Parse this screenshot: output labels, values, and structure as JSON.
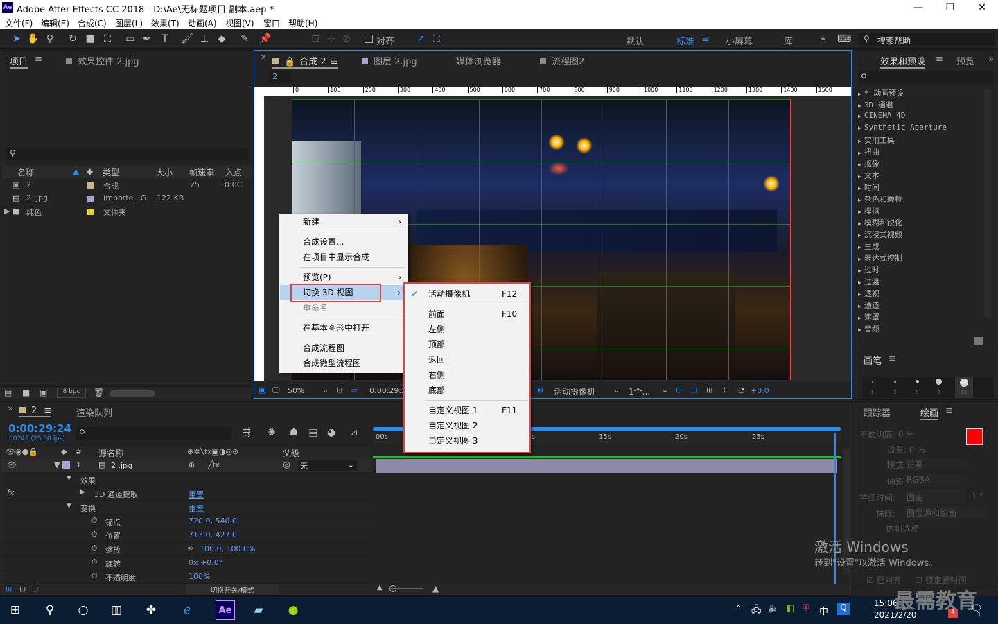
{
  "window": {
    "title": "Adobe After Effects CC 2018 - D:\\Ae\\无标题项目 副本.aep *",
    "app_icon": "Ae"
  },
  "menubar": [
    "文件(F)",
    "编辑(E)",
    "合成(C)",
    "图层(L)",
    "效果(T)",
    "动画(A)",
    "视图(V)",
    "窗口",
    "帮助(H)"
  ],
  "toolbar": {
    "align_label": "对齐",
    "workspaces": [
      "默认",
      "标准",
      "小屏幕",
      "库"
    ],
    "active_workspace": "标准",
    "search_placeholder": "搜索帮助"
  },
  "project_panel": {
    "tab": "项目",
    "tab2": "效果控件 2.jpg",
    "columns": [
      "名称",
      "类型",
      "大小",
      "帧速率",
      "入点"
    ],
    "items": [
      {
        "name": "2",
        "type": "合成",
        "size": "",
        "fps": "25",
        "in": "0:0C"
      },
      {
        "name": "2 .jpg",
        "type": "Importe...G",
        "size": "122 KB",
        "fps": "",
        "in": ""
      },
      {
        "name": "纯色",
        "type": "文件夹",
        "size": "",
        "fps": "",
        "in": ""
      }
    ],
    "bpc": "8 bpc"
  },
  "comp_panel": {
    "tabs": [
      "合成 2",
      "图层 2.jpg",
      "媒体浏览器",
      "流程图2"
    ],
    "breadcrumb": "2",
    "ruler": [
      "0",
      "100",
      "200",
      "300",
      "400",
      "500",
      "600",
      "700",
      "800",
      "900",
      "1000",
      "1100",
      "1200",
      "1300",
      "1400",
      "1500"
    ],
    "zoom": "50%",
    "timecode": "0:00:29:24",
    "camera": "活动摄像机",
    "views": "1个...",
    "exposure": "+0.0"
  },
  "context_menu": {
    "items": [
      "新建",
      "合成设置...",
      "在项目中显示合成",
      "预览(P)",
      "切换 3D 视图",
      "重命名",
      "在基本图形中打开",
      "合成流程图",
      "合成微型流程图"
    ],
    "highlighted": "切换 3D 视图",
    "disabled": "重命名"
  },
  "submenu": {
    "items": [
      {
        "label": "活动摄像机",
        "key": "F12",
        "checked": true
      },
      {
        "label": "前面",
        "key": "F10"
      },
      {
        "label": "左侧",
        "key": ""
      },
      {
        "label": "顶部",
        "key": ""
      },
      {
        "label": "返回",
        "key": ""
      },
      {
        "label": "右侧",
        "key": ""
      },
      {
        "label": "底部",
        "key": ""
      },
      {
        "label": "自定义视图 1",
        "key": "F11"
      },
      {
        "label": "自定义视图 2",
        "key": ""
      },
      {
        "label": "自定义视图 3",
        "key": ""
      }
    ]
  },
  "effects_panel": {
    "tab": "效果和预设",
    "tab2": "预览",
    "items": [
      "* 动画预设",
      "3D 通道",
      "CINEMA 4D",
      "Synthetic Aperture",
      "实用工具",
      "扭曲",
      "抠像",
      "文本",
      "时间",
      "杂色和颗粒",
      "模拟",
      "模糊和锐化",
      "沉浸式视频",
      "生成",
      "表达式控制",
      "过时",
      "过渡",
      "透视",
      "通道",
      "遮罩",
      "音频"
    ]
  },
  "brush_panel": {
    "tab": "画笔",
    "sizes": [
      "1",
      "3",
      "5",
      "9",
      "13"
    ]
  },
  "paint_panel": {
    "tab_tracker": "跟踪器",
    "tab_paint": "绘画",
    "opacity": "不透明度: 0 %",
    "flow": "流量: 0 %",
    "mode_label": "模式:",
    "mode": "正常",
    "channel_label": "通道:",
    "channel": "RGBA",
    "duration_label": "持续时间:",
    "duration": "固定",
    "frames": "1 f",
    "erase_label": "抹除:",
    "erase": "图层源和绘画",
    "clone_label": "仿制选项",
    "locked_source": "锁定源时间",
    "aligned": "已对齐"
  },
  "timeline": {
    "tab": "2",
    "render_tab": "渲染队列",
    "time": "0:00:29:24",
    "frames": "00749 (25.00 fps)",
    "headers": {
      "source": "源名称",
      "parent": "父级"
    },
    "layer": {
      "num": "1",
      "name": "2 .jpg",
      "parent": "无"
    },
    "props": [
      {
        "name": "效果",
        "value": ""
      },
      {
        "name": "3D 通道提取",
        "value": "重置"
      },
      {
        "name": "变换",
        "value": "重置"
      },
      {
        "name": "锚点",
        "value": "720.0, 540.0"
      },
      {
        "name": "位置",
        "value": "713.0, 427.0"
      },
      {
        "name": "缩放",
        "value": "100.0, 100.0%"
      },
      {
        "name": "旋转",
        "value": "0x +0.0°"
      },
      {
        "name": "不透明度",
        "value": "100%"
      }
    ],
    "ruler": [
      "00s",
      "05s",
      "10s",
      "15s",
      "20s",
      "25s"
    ],
    "footer": "切换开关/模式"
  },
  "watermark": {
    "line1": "激活 Windows",
    "line2": "转到\"设置\"以激活 Windows。",
    "brand": "最需教育"
  },
  "taskbar": {
    "time": "15:06",
    "date": "2021/2/20",
    "ime": "中",
    "badge": "4",
    "badge2": "1"
  },
  "colors": {
    "accent": "#2d8ceb",
    "menu_highlight": "#b7d3ee",
    "red_box": "#e04343",
    "fg_color": "#ff0000",
    "grid": "#00a000"
  }
}
